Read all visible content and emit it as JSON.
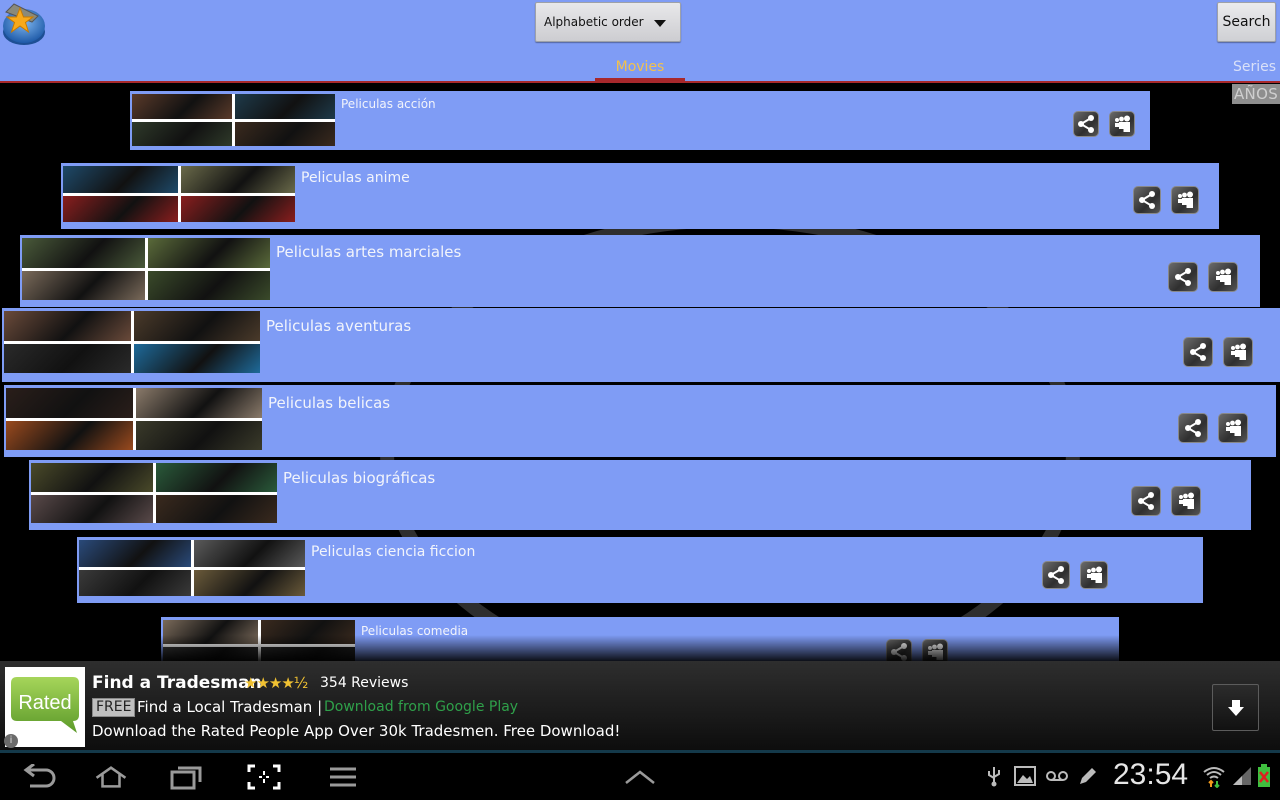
{
  "header": {
    "sort_selected": "Alphabetic order",
    "search_label": "Search",
    "tabs": [
      {
        "label": "Movies",
        "active": true
      },
      {
        "label": "Series",
        "active": false
      }
    ],
    "filter_label": "AÑOS"
  },
  "colors": {
    "header_bg": "#7f9cf5",
    "accent_red": "#a8282c",
    "active_tab": "#f2c14e",
    "card_bg": "#7f9cf5",
    "ad_cta": "#2fa04a"
  },
  "categories": [
    {
      "title": "Peliculas acción",
      "share_icon": "share-icon",
      "myspace_icon": "myspace-icon"
    },
    {
      "title": "Peliculas anime",
      "share_icon": "share-icon",
      "myspace_icon": "myspace-icon"
    },
    {
      "title": "Peliculas artes marciales",
      "share_icon": "share-icon",
      "myspace_icon": "myspace-icon"
    },
    {
      "title": "Peliculas aventuras",
      "share_icon": "share-icon",
      "myspace_icon": "myspace-icon"
    },
    {
      "title": "Peliculas belicas",
      "share_icon": "share-icon",
      "myspace_icon": "myspace-icon"
    },
    {
      "title": "Peliculas biográficas",
      "share_icon": "share-icon",
      "myspace_icon": "myspace-icon"
    },
    {
      "title": "Peliculas ciencia ficcion",
      "share_icon": "share-icon",
      "myspace_icon": "myspace-icon"
    },
    {
      "title": "Peliculas comedia",
      "share_icon": "share-icon",
      "myspace_icon": "myspace-icon"
    }
  ],
  "ad": {
    "logo_text": "Rated",
    "title": "Find a Tradesman",
    "rating": 4.5,
    "stars": "★★★★½",
    "reviews": "354 Reviews",
    "free_badge": "FREE",
    "subtitle": "Find a Local Tradesman |",
    "cta": "Download from Google Play",
    "description": "Download the Rated People App Over 30k Tradesmen. Free Download!",
    "info": "i"
  },
  "system_bar": {
    "nav_buttons": [
      "back",
      "home",
      "recent-apps",
      "screenshot",
      "menu",
      "expand"
    ],
    "clock": "23:54",
    "status_icons": [
      "usb-icon",
      "gallery-icon",
      "voicemail-icon",
      "edit-icon",
      "wifi-icon",
      "signal-icon",
      "battery-icon"
    ]
  }
}
